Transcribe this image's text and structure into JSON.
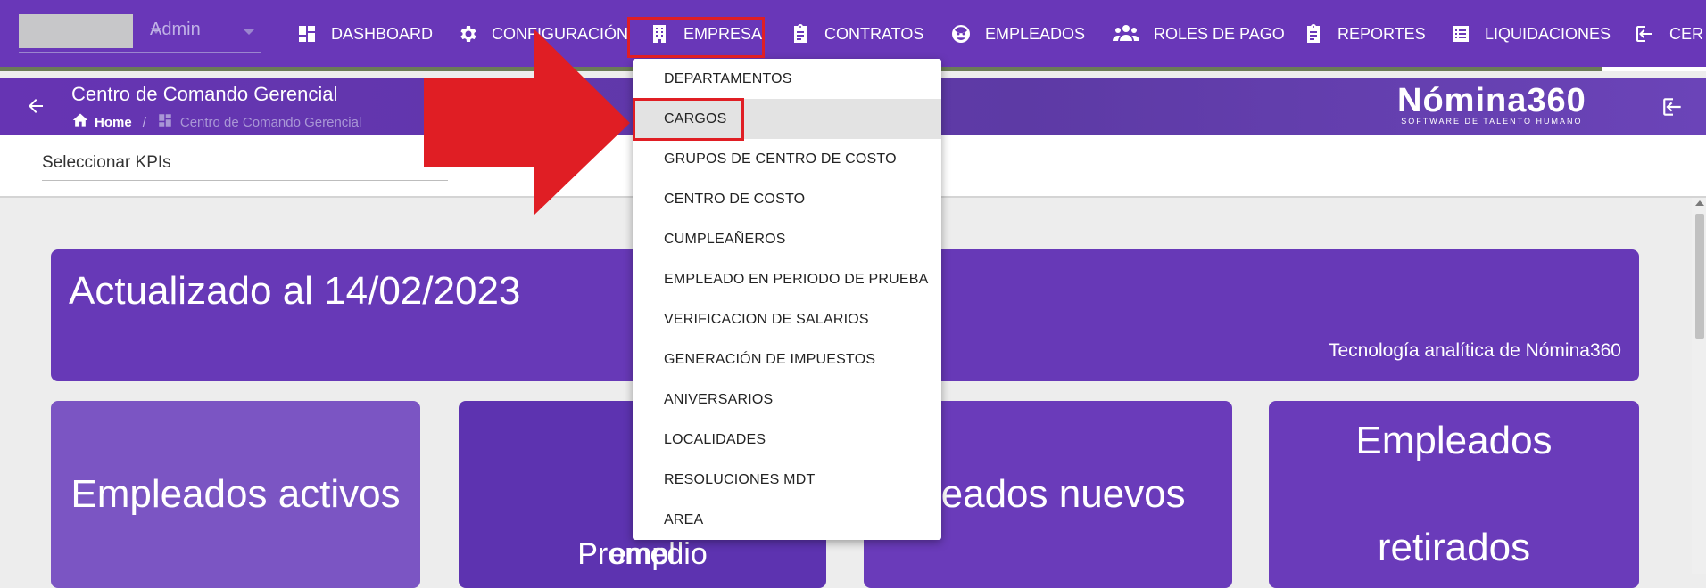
{
  "topnav": {
    "user": {
      "name": "Admin"
    },
    "items": [
      {
        "label": "DASHBOARD",
        "icon": "dashboard-icon"
      },
      {
        "label": "CONFIGURACIÓN",
        "icon": "gear-icon"
      },
      {
        "label": "EMPRESA",
        "icon": "building-icon"
      },
      {
        "label": "CONTRATOS",
        "icon": "clipboard-icon"
      },
      {
        "label": "EMPLEADOS",
        "icon": "face-icon"
      },
      {
        "label": "ROLES DE PAGO",
        "icon": "people-icon"
      },
      {
        "label": "REPORTES",
        "icon": "clipboard-icon"
      },
      {
        "label": "LIQUIDACIONES",
        "icon": "list-icon"
      },
      {
        "label": "CER",
        "icon": "logout-icon"
      }
    ]
  },
  "header": {
    "title": "Centro de Comando Gerencial",
    "breadcrumb": {
      "home": "Home",
      "current": "Centro de Comando Gerencial"
    },
    "brand": {
      "name": "Nómina360",
      "tagline": "SOFTWARE DE TALENTO HUMANO"
    }
  },
  "kpi_selector": {
    "label": "Seleccionar KPIs"
  },
  "banner": {
    "updated": "Actualizado al 14/02/2023",
    "tech": "Tecnología analítica de Nómina360"
  },
  "cards": [
    {
      "label": "Empleados activos"
    },
    {
      "label_line1": "Promedio",
      "label_line2": "empl"
    },
    {
      "label": "pleados nuevos"
    },
    {
      "label_line1": "Empleados",
      "label_line2": "retirados"
    }
  ],
  "empresa_menu": {
    "items": [
      "DEPARTAMENTOS",
      "CARGOS",
      "GRUPOS DE CENTRO DE COSTO",
      "CENTRO DE COSTO",
      "CUMPLEAÑEROS",
      "EMPLEADO EN PERIODO DE PRUEBA",
      "VERIFICACION DE SALARIOS",
      "GENERACIÓN DE IMPUESTOS",
      "ANIVERSARIOS",
      "LOCALIDADES",
      "RESOLUCIONES MDT",
      "AREA"
    ],
    "active": "CARGOS"
  },
  "colors": {
    "nav_bg": "#6937b8",
    "annotation_red": "#e01e24",
    "banner_bg": "#6739b7"
  }
}
